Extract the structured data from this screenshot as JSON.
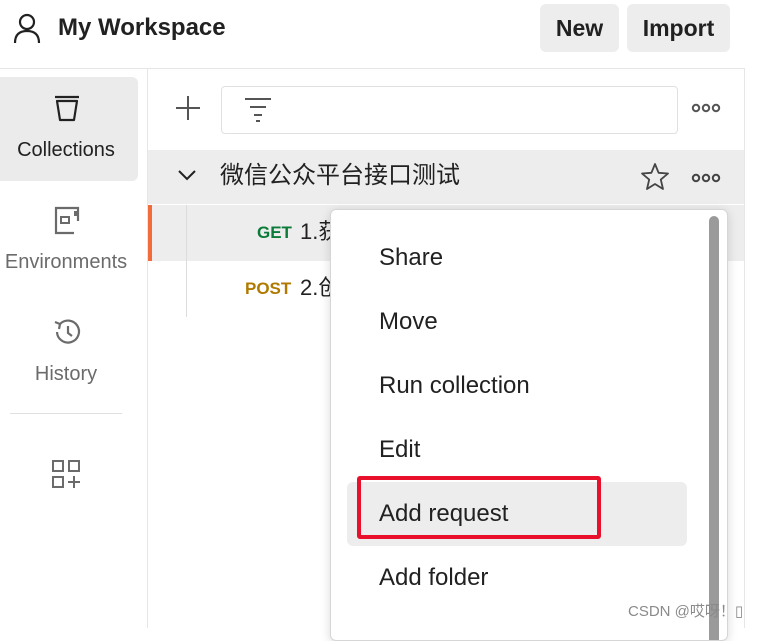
{
  "header": {
    "workspace_title": "My Workspace",
    "new_label": "New",
    "import_label": "Import"
  },
  "sidebar": {
    "items": [
      {
        "label": "Collections",
        "icon": "collections-icon",
        "active": true
      },
      {
        "label": "Environments",
        "icon": "environments-icon",
        "active": false
      },
      {
        "label": "History",
        "icon": "history-icon",
        "active": false
      },
      {
        "label": "",
        "icon": "configure-workbench-icon",
        "active": false
      }
    ]
  },
  "collections": {
    "filter_placeholder": "",
    "collection_name": "微信公众平台接口测试",
    "requests": [
      {
        "method": "GET",
        "name": "1.获"
      },
      {
        "method": "POST",
        "name": "2.创"
      }
    ]
  },
  "context_menu": {
    "items": [
      "Share",
      "Move",
      "Run collection",
      "Edit",
      "Add request",
      "Add folder"
    ],
    "highlighted": "Add request"
  },
  "watermark": "CSDN @哎呀！▯",
  "colors": {
    "get_method": "#0c7b3a",
    "post_method": "#b07a00",
    "active_accent": "#f26b3a",
    "highlight_border": "#e8102a"
  }
}
